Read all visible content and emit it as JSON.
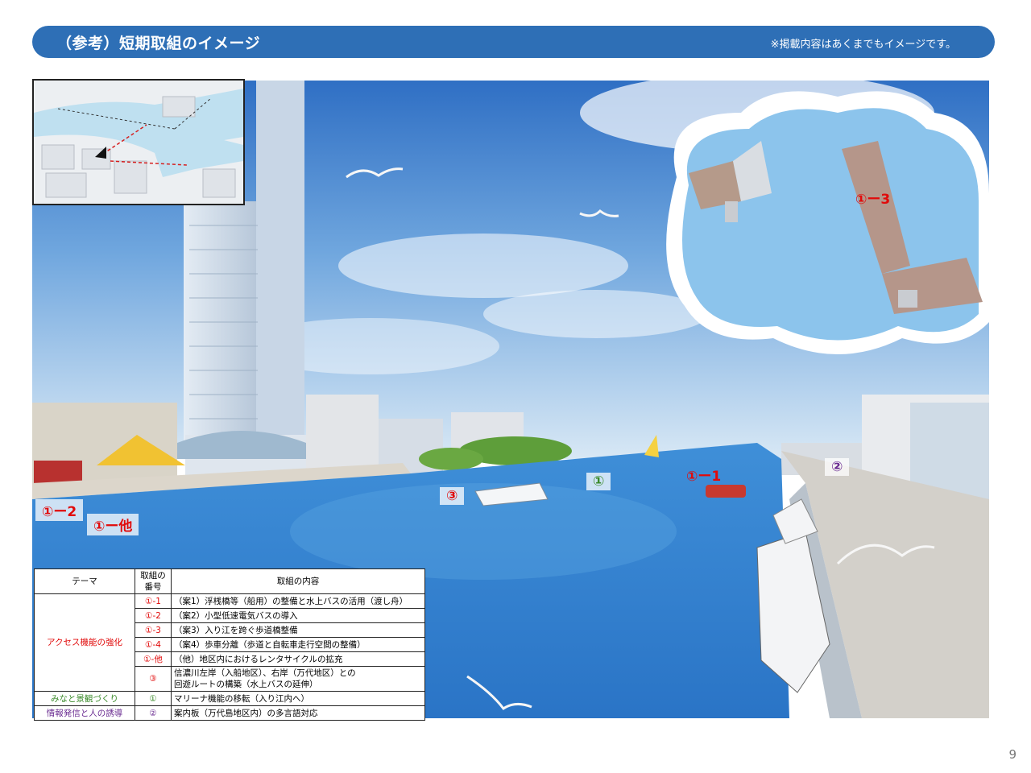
{
  "header": {
    "title": "（参考）短期取組のイメージ",
    "note": "※掲載内容はあくまでもイメージです。"
  },
  "markers": {
    "m1_1": "①ー1",
    "m1_2": "①ー2",
    "m1_3": "①ー3",
    "m1_other": "①ー他",
    "m1": "①",
    "m2": "②",
    "m3": "③"
  },
  "table": {
    "headers": {
      "theme": "テーマ",
      "number": "取組の番号",
      "content": "取組の内容"
    },
    "themes": {
      "access": "アクセス機能の強化",
      "landscape": "みなと景観づくり",
      "info": "情報発信と人の誘導"
    },
    "rows": [
      {
        "num": "①-1",
        "content": "（案1）浮桟橋等（船用）の整備と水上バスの活用（渡し舟）"
      },
      {
        "num": "①-2",
        "content": "（案2）小型低速電気バスの導入"
      },
      {
        "num": "①-3",
        "content": "（案3）入り江を跨ぐ歩道橋整備"
      },
      {
        "num": "①-4",
        "content": "（案4）歩車分離（歩道と自転車走行空間の整備）"
      },
      {
        "num": "①-他",
        "content": "（他）地区内におけるレンタサイクルの拡充"
      },
      {
        "num": "③",
        "content": "信濃川左岸（入船地区）、右岸（万代地区）との",
        "content2": "回遊ルートの構築（水上バスの延伸）"
      },
      {
        "num": "①",
        "content": "マリーナ機能の移転（入り江内へ）"
      },
      {
        "num": "②",
        "content": "案内板（万代島地区内）の多言語対応"
      }
    ]
  },
  "page_number": "9",
  "colors": {
    "header": "#2e6fb6",
    "marker_red": "#e10a0a",
    "marker_green": "#3a8a2a",
    "marker_purple": "#6a2c91"
  }
}
